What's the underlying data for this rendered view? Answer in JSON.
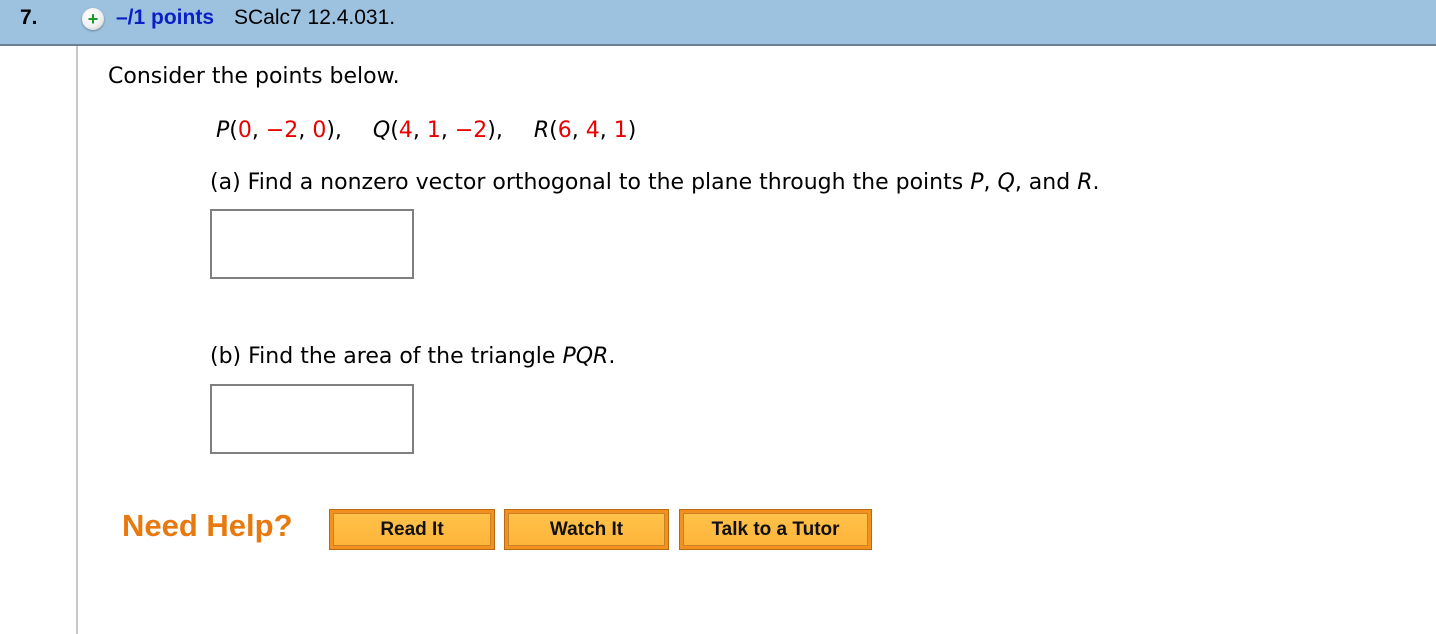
{
  "header": {
    "question_number": "7.",
    "expand_icon": "plus-icon",
    "points_label": "–/1 points",
    "source": "SCalc7 12.4.031."
  },
  "question": {
    "intro": "Consider the points below.",
    "points": [
      {
        "name": "P",
        "coords": [
          "0",
          "−2",
          "0"
        ]
      },
      {
        "name": "Q",
        "coords": [
          "4",
          "1",
          "−2"
        ]
      },
      {
        "name": "R",
        "coords": [
          "6",
          "4",
          "1"
        ]
      }
    ],
    "part_a": {
      "prefix": "(a) Find a nonzero vector orthogonal to the plane through the points ",
      "v1": "P",
      "sep1": ", ",
      "v2": "Q",
      "sep2": ", and ",
      "v3": "R",
      "suffix": ".",
      "answer_value": ""
    },
    "part_b": {
      "prefix": "(b) Find the area of the triangle ",
      "v": "PQR",
      "suffix": ".",
      "answer_value": ""
    }
  },
  "help": {
    "label": "Need Help?",
    "buttons": [
      "Read It",
      "Watch It",
      "Talk to a Tutor"
    ]
  },
  "colors": {
    "header_bg": "#9dc2df",
    "points_link": "#0a1fc4",
    "coord_value": "#e80000",
    "need_help": "#e8790f",
    "button_fill": "#ffb43a"
  }
}
